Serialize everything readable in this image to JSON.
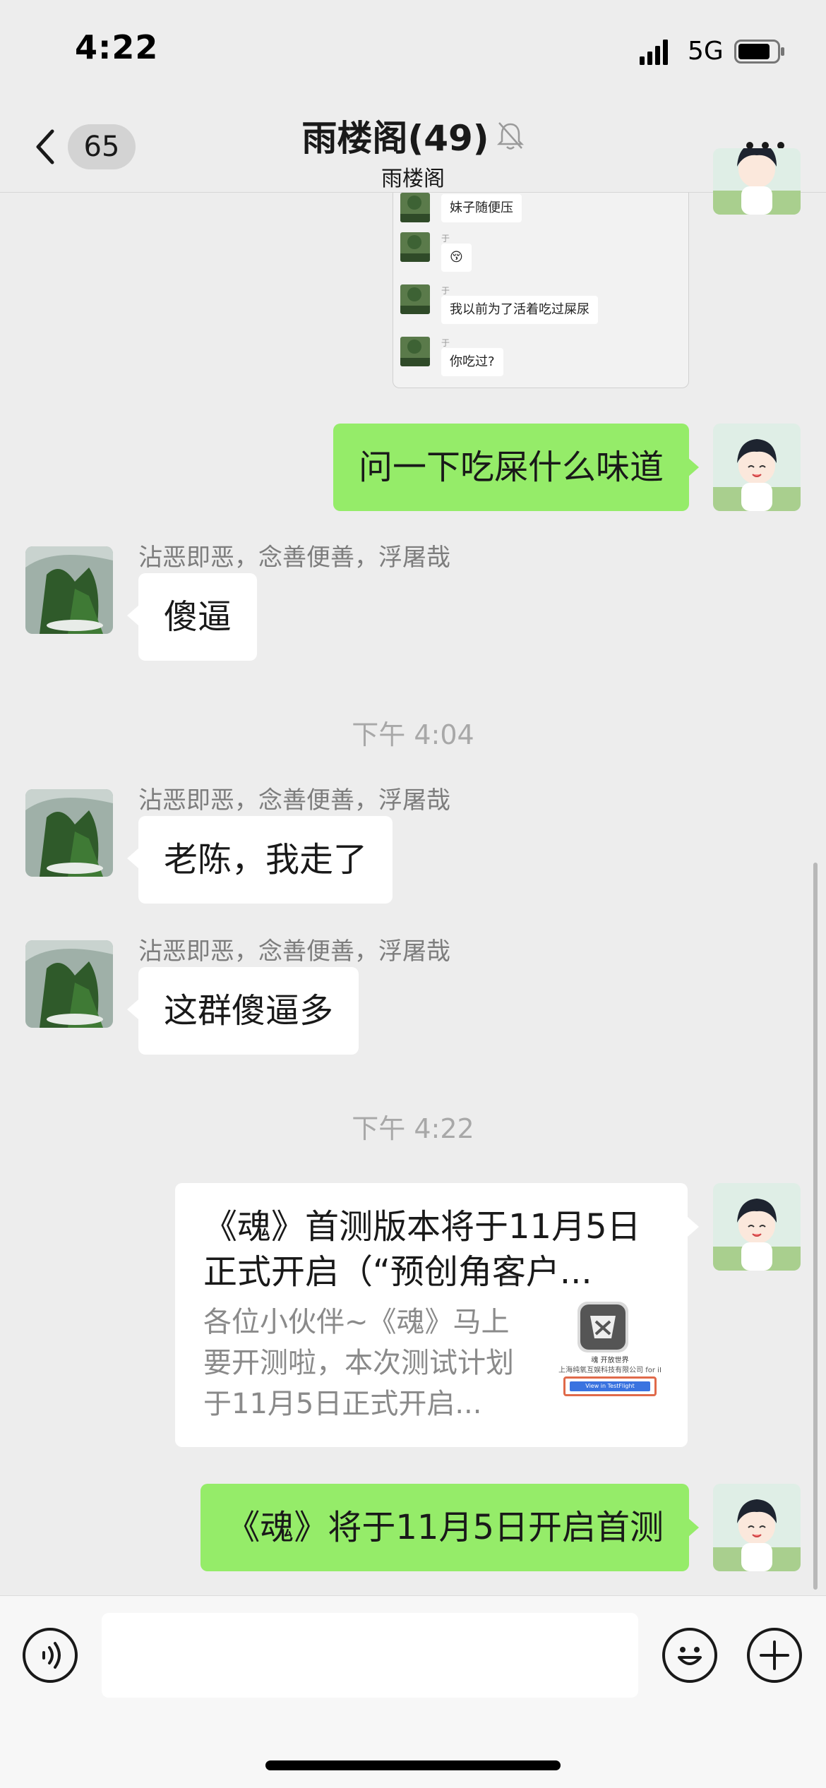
{
  "status_bar": {
    "time": "4:22",
    "network": "5G"
  },
  "nav": {
    "unread_count": "65",
    "title": "雨楼阁(49)",
    "subtitle": "雨楼阁"
  },
  "screenshot_preview": {
    "rows": [
      {
        "name": "",
        "text": "妹子随便压"
      },
      {
        "name": "于",
        "text": "😚"
      },
      {
        "name": "于",
        "text": "我以前为了活着吃过屎尿"
      },
      {
        "name": "于",
        "text": "你吃过?"
      }
    ]
  },
  "messages": [
    {
      "side": "right",
      "text": "问一下吃屎什么味道"
    },
    {
      "side": "left",
      "sender": "沾恶即恶，念善便善，浮屠哉",
      "text": "傻逼"
    },
    {
      "timestamp": "下午 4:04"
    },
    {
      "side": "left",
      "sender": "沾恶即恶，念善便善，浮屠哉",
      "text": "老陈，我走了"
    },
    {
      "side": "left",
      "sender": "沾恶即恶，念善便善，浮屠哉",
      "text": "这群傻逼多"
    },
    {
      "timestamp": "下午 4:22"
    },
    {
      "side": "right",
      "text": "《魂》将于11月5日开启首测"
    }
  ],
  "link_card": {
    "title": "《魂》首测版本将于11月5日正式开启（“预创角客户...",
    "description": "各位小伙伴~《魂》马上要开测啦，本次测试计划于11月5日正式开启...",
    "thumb_title": "魂 开放世界",
    "thumb_company": "上海纯氧互娱科技有限公司 for iI",
    "thumb_button": "View in TestFlight"
  },
  "colors": {
    "background": "#ededed",
    "bubble_self": "#95ec69",
    "bubble_other": "#ffffff",
    "timestamp_text": "#a8a8a8"
  },
  "icons": [
    "back-chevron-icon",
    "mute-bell-icon",
    "more-dots-icon",
    "voice-icon",
    "emoji-icon",
    "add-icon"
  ]
}
